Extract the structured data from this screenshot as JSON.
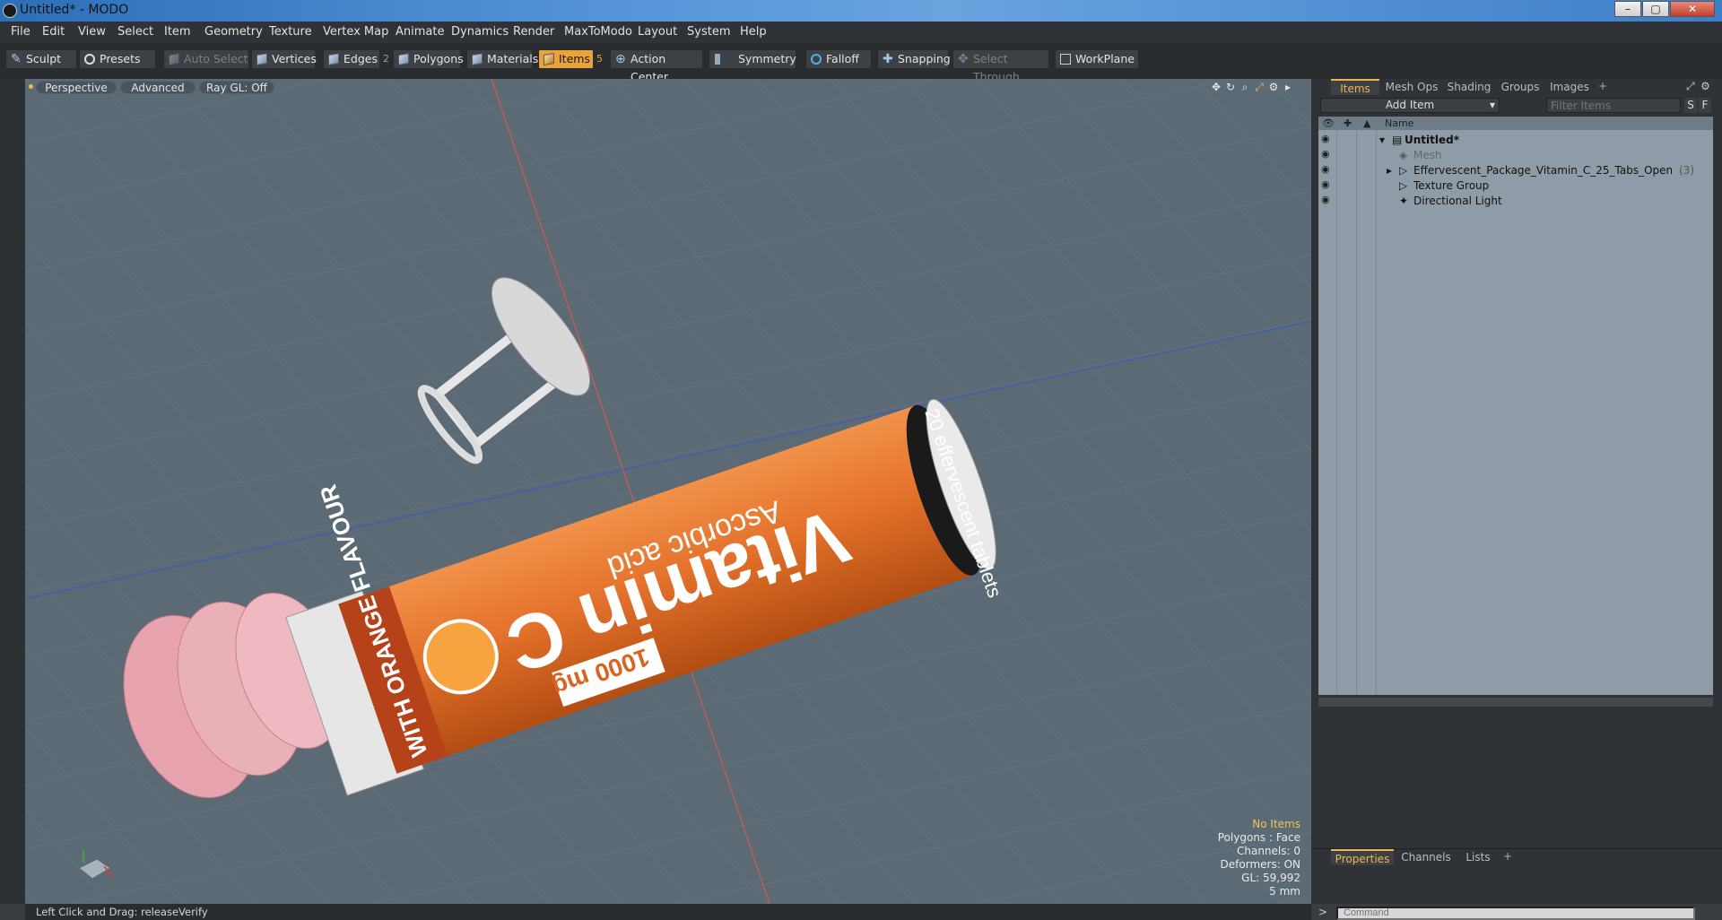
{
  "window": {
    "title": "Untitled* - MODO"
  },
  "menu": [
    "File",
    "Edit",
    "View",
    "Select",
    "Item",
    "Geometry",
    "Texture",
    "Vertex Map",
    "Animate",
    "Dynamics",
    "Render",
    "MaxToModo",
    "Layout",
    "System",
    "Help"
  ],
  "toolbar": {
    "sculpt": "Sculpt",
    "presets": "Presets",
    "auto_select": "Auto Select",
    "vertices": "Vertices",
    "edges": "Edges",
    "edges_count": "2",
    "polygons": "Polygons",
    "materials": "Materials",
    "items": "Items",
    "items_count": "5",
    "action_center": "Action Center",
    "symmetry": "Symmetry",
    "falloff": "Falloff",
    "snapping": "Snapping",
    "select_through": "Select Through",
    "workplane": "WorkPlane"
  },
  "viewport": {
    "view": "Perspective",
    "mode": "Advanced",
    "raygl": "Ray GL: Off",
    "hud": {
      "no_items": "No Items",
      "polygons": "Polygons : Face",
      "channels": "Channels: 0",
      "deformers": "Deformers: ON",
      "gl": "GL: 59,992",
      "scale": "5 mm"
    },
    "label": {
      "brand": "Vitamin C",
      "sub": "Ascorbic acid",
      "dose": "1000 mg",
      "flavor": "WITH ORANGE FLAVOUR",
      "count": "20 effervescent tablets"
    }
  },
  "right": {
    "tabs": [
      "Items",
      "Mesh Ops",
      "Shading",
      "Groups",
      "Images"
    ],
    "add_item": "Add Item",
    "filter_placeholder": "Filter Items",
    "filter_s": "S",
    "filter_f": "F",
    "name_col": "Name",
    "tree": [
      {
        "label": "Untitled*"
      },
      {
        "label": "Mesh"
      },
      {
        "label": "Effervescent_Package_Vitamin_C_25_Tabs_Open",
        "count": "(3)"
      },
      {
        "label": "Texture Group"
      },
      {
        "label": "Directional Light"
      }
    ],
    "bottom_tabs": [
      "Properties",
      "Channels",
      "Lists"
    ],
    "command_placeholder": "Command"
  },
  "status": {
    "text": "Left Click and Drag:  releaseVerify"
  }
}
